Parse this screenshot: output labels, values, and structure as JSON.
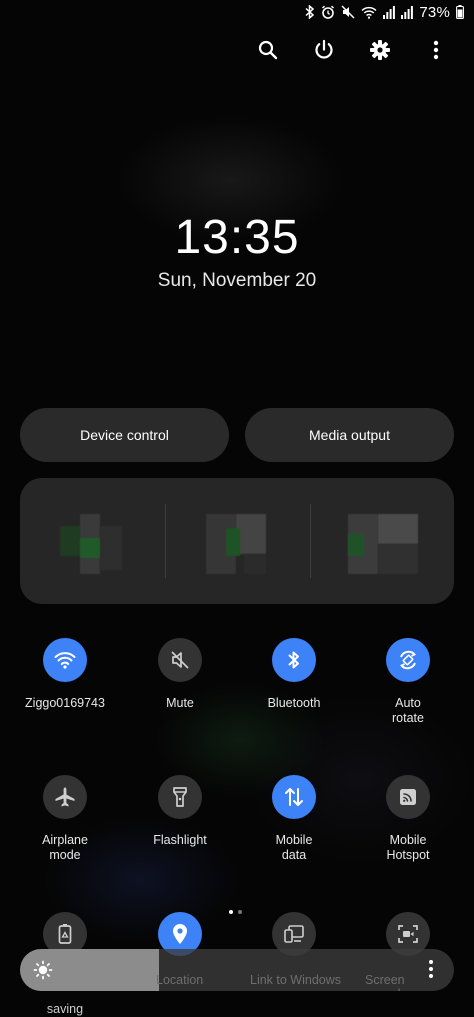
{
  "status_bar": {
    "battery_percent": "73%",
    "icons": [
      "bluetooth-icon",
      "alarm-icon",
      "mute-icon",
      "wifi-icon",
      "signal-icon",
      "signal-icon-2"
    ]
  },
  "top_actions": {
    "icons": [
      "search-icon",
      "power-icon",
      "settings-icon",
      "more-vert-icon"
    ]
  },
  "lock": {
    "time": "13:35",
    "date": "Sun, November 20"
  },
  "pills": {
    "device_control": "Device control",
    "media_output": "Media output"
  },
  "tiles_row1": [
    {
      "label": "Ziggo0169743",
      "icon": "wifi-icon",
      "on": true
    },
    {
      "label": "Mute",
      "icon": "mute-icon",
      "on": false
    },
    {
      "label": "Bluetooth",
      "icon": "bluetooth-icon",
      "on": true
    },
    {
      "label": "Auto\nrotate",
      "icon": "auto-rotate-icon",
      "on": true
    }
  ],
  "tiles_row2": [
    {
      "label": "Airplane\nmode",
      "icon": "airplane-icon",
      "on": false
    },
    {
      "label": "Flashlight",
      "icon": "flashlight-icon",
      "on": false
    },
    {
      "label": "Mobile\ndata",
      "icon": "mobile-data-icon",
      "on": true
    },
    {
      "label": "Mobile\nHotspot",
      "icon": "hotspot-icon",
      "on": false
    }
  ],
  "tiles_row3": [
    {
      "label": "saving",
      "icon": "power-saving-icon",
      "on": false
    },
    {
      "label": "Location",
      "icon": "location-icon",
      "on": true
    },
    {
      "label": "Link to Windows",
      "icon": "link-to-windows-icon",
      "on": false
    },
    {
      "label": "Screen recorder",
      "icon": "screen-recorder-icon",
      "on": false
    }
  ],
  "brightness": {
    "level": 0.32
  },
  "colors": {
    "accent": "#3e82f7",
    "tile_off": "#333333",
    "background": "#050505"
  }
}
